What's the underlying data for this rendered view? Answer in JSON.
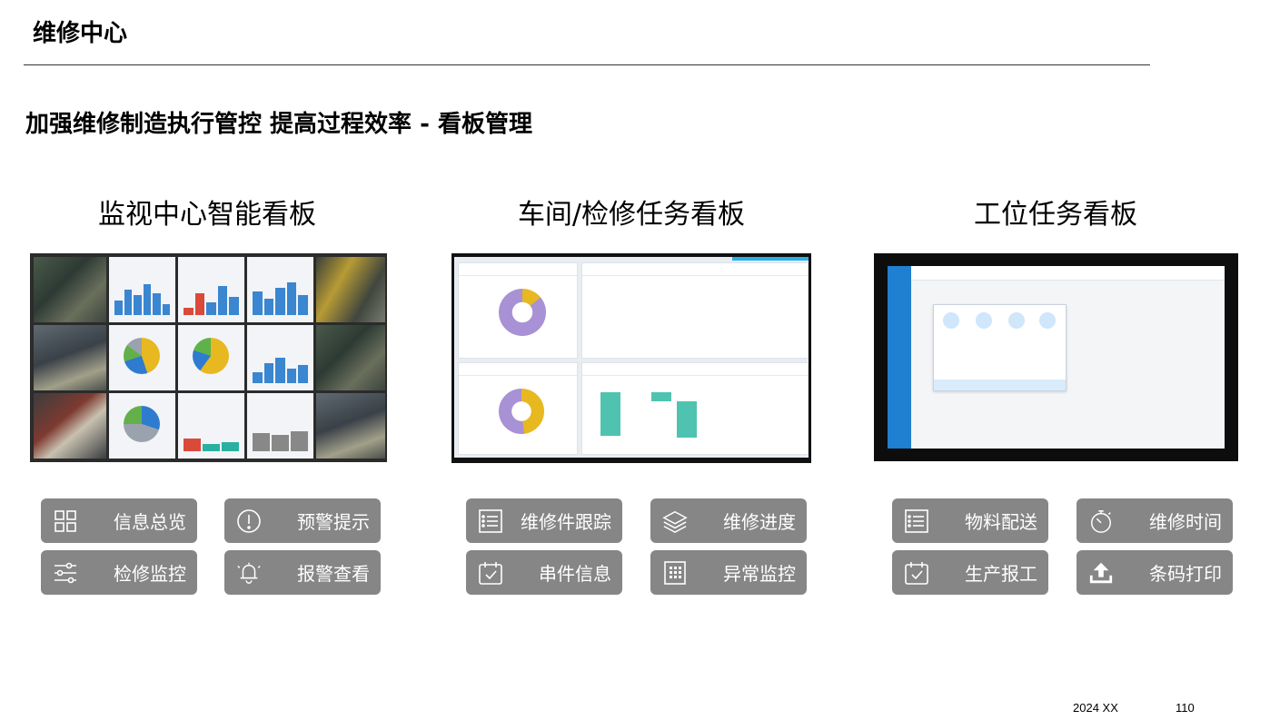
{
  "header": {
    "title": "维修中心",
    "subtitle": "加强维修制造执行管控 提高过程效率 - 看板管理"
  },
  "columns": [
    {
      "heading": "监视中心智能看板",
      "buttons": [
        {
          "label": "信息总览",
          "icon": "grid-icon"
        },
        {
          "label": "预警提示",
          "icon": "alert-circle-icon"
        },
        {
          "label": "检修监控",
          "icon": "sliders-icon"
        },
        {
          "label": "报警查看",
          "icon": "bell-icon"
        }
      ]
    },
    {
      "heading": "车间/检修任务看板",
      "buttons": [
        {
          "label": "维修件跟踪",
          "icon": "checklist-icon"
        },
        {
          "label": "维修进度",
          "icon": "layers-icon"
        },
        {
          "label": "串件信息",
          "icon": "calendar-check-icon"
        },
        {
          "label": "异常监控",
          "icon": "building-icon"
        }
      ]
    },
    {
      "heading": "工位任务看板",
      "buttons": [
        {
          "label": "物料配送",
          "icon": "checklist-icon"
        },
        {
          "label": "维修时间",
          "icon": "stopwatch-icon"
        },
        {
          "label": "生产报工",
          "icon": "calendar-check-icon"
        },
        {
          "label": "条码打印",
          "icon": "upload-icon"
        }
      ]
    }
  ],
  "footer": {
    "date": "2024 XX",
    "page": "110"
  },
  "colors": {
    "button_bg": "#868686",
    "accent_blue": "#1f7fd0"
  }
}
